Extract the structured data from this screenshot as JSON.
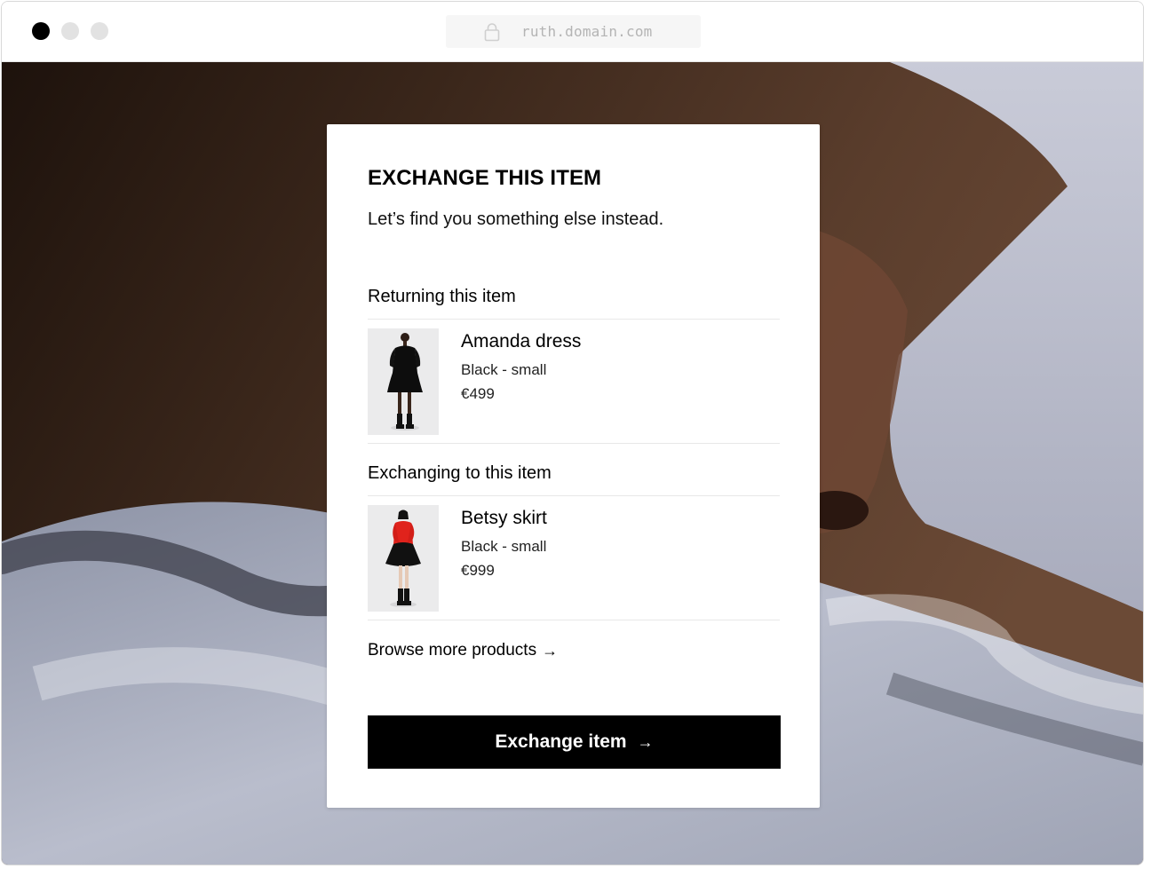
{
  "browser": {
    "url": "ruth.domain.com",
    "window_controls": [
      "close",
      "minimize",
      "maximize"
    ]
  },
  "modal": {
    "title": "EXCHANGE THIS ITEM",
    "subtitle": "Let’s find you something else instead.",
    "returning": {
      "label": "Returning this item",
      "item": {
        "name": "Amanda dress",
        "variant": "Black - small",
        "price": "€499"
      }
    },
    "exchanging": {
      "label": "Exchanging to this item",
      "item": {
        "name": "Betsy skirt",
        "variant": "Black - small",
        "price": "€999"
      }
    },
    "browse_link": {
      "label": "Browse more products",
      "icon": "arrow-right-icon"
    },
    "cta": {
      "label": "Exchange item",
      "icon": "arrow-right-icon"
    }
  },
  "colors": {
    "accent": "#000000",
    "card_bg": "#ffffff",
    "url_text": "#b4b4b4",
    "skirt_model_top": "#e0231c"
  }
}
